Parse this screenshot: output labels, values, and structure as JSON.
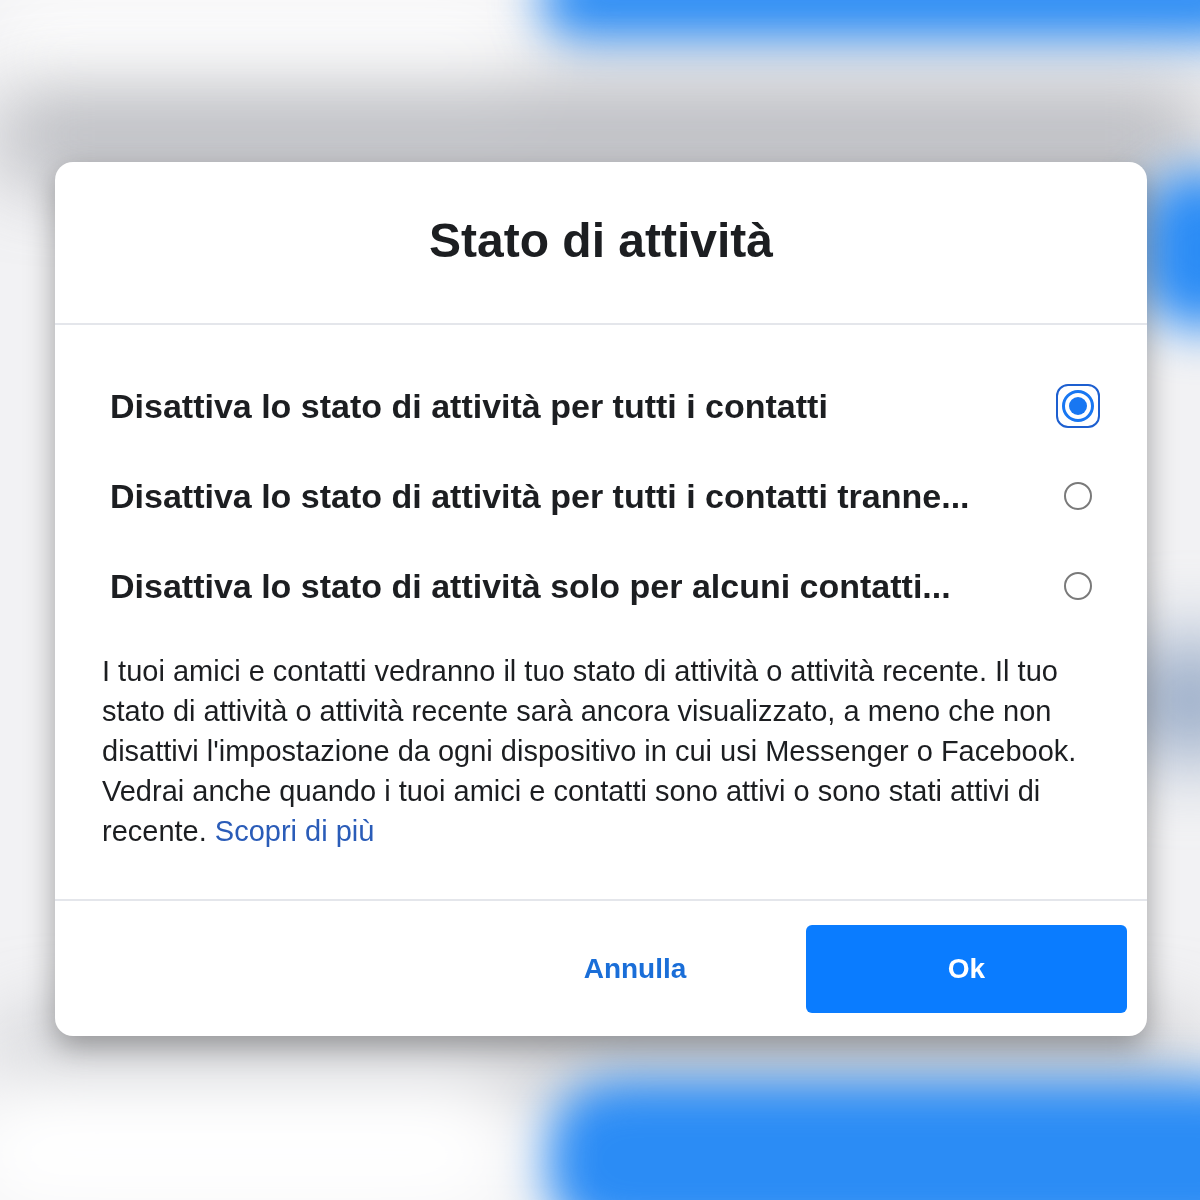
{
  "dialog": {
    "title": "Stato di attività",
    "options": [
      {
        "label": "Disattiva lo stato di attività per tutti i contatti",
        "selected": true
      },
      {
        "label": "Disattiva lo stato di attività per tutti i contatti tranne...",
        "selected": false
      },
      {
        "label": "Disattiva lo stato di attività solo per alcuni contatti...",
        "selected": false
      }
    ],
    "description": "I tuoi amici e contatti vedranno il tuo stato di attività o attività recente. Il tuo stato di attività o attività recente sarà ancora visualizzato, a meno che non disattivi l'impostazione da ogni dispositivo in cui usi Messenger o Facebook. Vedrai anche quando i tuoi amici e contatti sono attivi o sono stati attivi di recente.",
    "link": "Scopri di più",
    "buttons": [
      {
        "label": "Annulla",
        "kind": "secondary"
      },
      {
        "label": "Ok",
        "kind": "primary"
      }
    ]
  }
}
